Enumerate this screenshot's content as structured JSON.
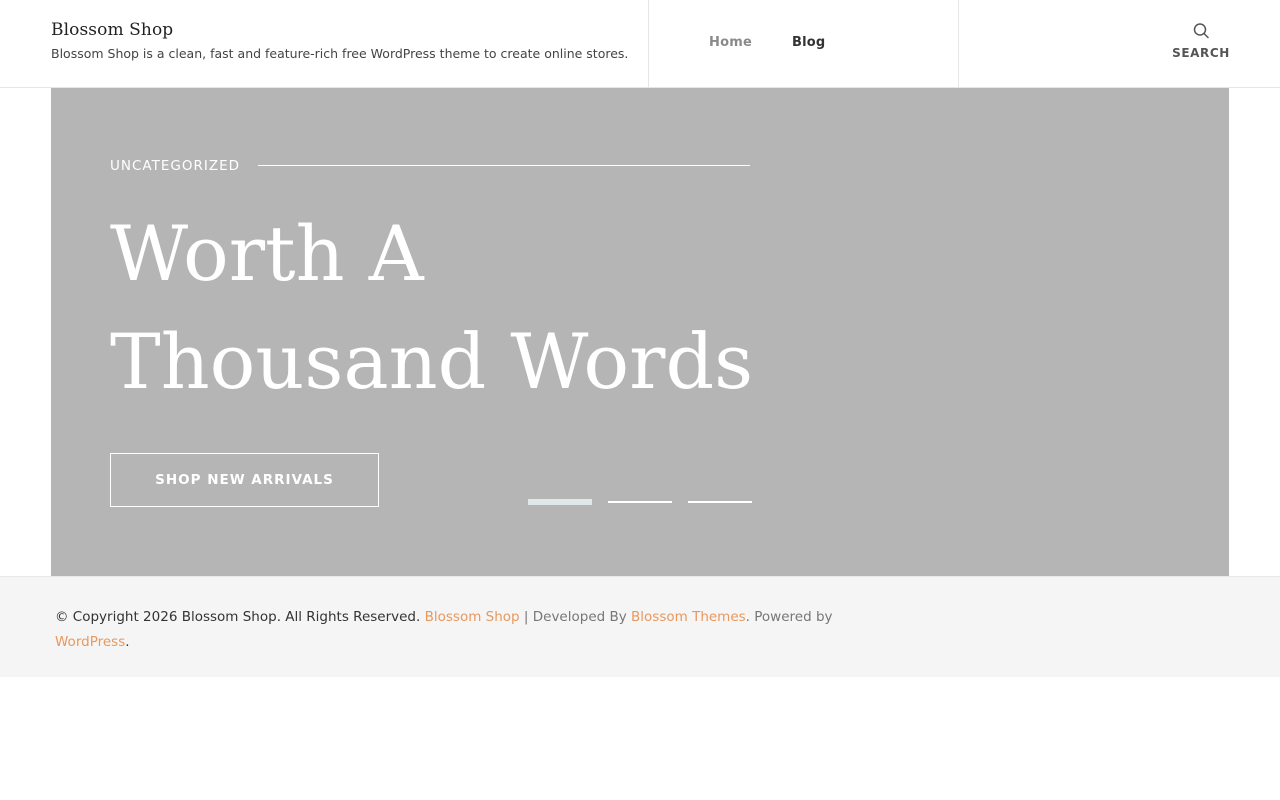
{
  "header": {
    "site_title": "Blossom Shop",
    "site_description": "Blossom Shop is a clean, fast and feature-rich free WordPress theme to create online stores.",
    "nav": [
      {
        "label": "Home"
      },
      {
        "label": "Blog"
      }
    ],
    "search_label": "SEARCH",
    "search_icon": "search-icon"
  },
  "hero": {
    "category": "UNCATEGORIZED",
    "title": "Worth A Thousand Words",
    "cta_label": "SHOP NEW ARRIVALS",
    "slides_total": 3,
    "active_slide": 1,
    "background_color": "#b5b5b5"
  },
  "footer": {
    "copyright": "© Copyright 2026 Blossom Shop. All Rights Reserved.",
    "theme_name": "Blossom Shop",
    "developed_by": " | Developed By ",
    "developer_link": "Blossom Themes",
    "powered_by": ". Powered by",
    "platform_link": "WordPress",
    "end_punct": ".",
    "link_color": "#e8985e"
  }
}
